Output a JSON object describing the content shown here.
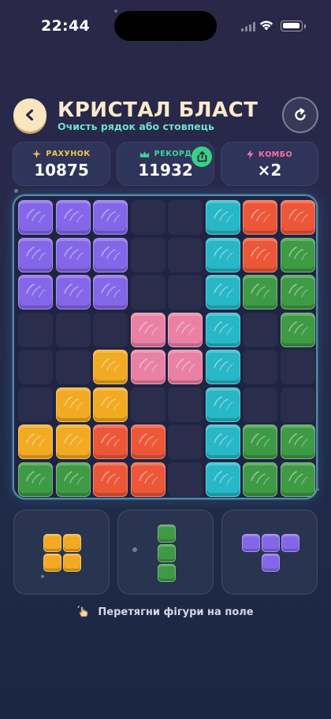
{
  "status_bar": {
    "time": "22:44"
  },
  "header": {
    "title": "КРИСТАЛ БЛАСТ",
    "subtitle": "Очисть рядок або стовпець"
  },
  "stats": {
    "score": {
      "label": "РАХУНОК",
      "value": "10875",
      "color": "#f5c54a",
      "icon": "sparkle-icon"
    },
    "record": {
      "label": "РЕКОРД",
      "value": "11932",
      "color": "#3fd49a",
      "icon": "crown-icon"
    },
    "combo": {
      "label": "КОМБО",
      "value": "×2",
      "color": "#ff6fa6",
      "icon": "lightning-icon"
    }
  },
  "colors": {
    "purple": "#8467e8",
    "teal": "#27b7c7",
    "red": "#ec5738",
    "green": "#3f9a45",
    "pink": "#ea80a3",
    "yellow": "#f1aa22"
  },
  "board": [
    [
      "purple",
      "purple",
      "purple",
      "empty",
      "empty",
      "teal",
      "red",
      "red"
    ],
    [
      "purple",
      "purple",
      "purple",
      "empty",
      "empty",
      "teal",
      "red",
      "green"
    ],
    [
      "purple",
      "purple",
      "purple",
      "empty",
      "empty",
      "teal",
      "green",
      "green"
    ],
    [
      "empty",
      "empty",
      "empty",
      "pink",
      "pink",
      "teal",
      "empty",
      "green"
    ],
    [
      "empty",
      "empty",
      "yellow",
      "pink",
      "pink",
      "teal",
      "empty",
      "empty"
    ],
    [
      "empty",
      "yellow",
      "yellow",
      "empty",
      "empty",
      "teal",
      "empty",
      "empty"
    ],
    [
      "yellow",
      "yellow",
      "red",
      "red",
      "empty",
      "teal",
      "green",
      "green"
    ],
    [
      "green",
      "green",
      "red",
      "red",
      "empty",
      "teal",
      "green",
      "green"
    ]
  ],
  "pieces": [
    {
      "color": "yellow",
      "cells": [
        [
          0,
          0
        ],
        [
          0,
          1
        ],
        [
          1,
          0
        ],
        [
          1,
          1
        ]
      ]
    },
    {
      "color": "green",
      "cells": [
        [
          0,
          0
        ],
        [
          1,
          0
        ],
        [
          2,
          0
        ]
      ]
    },
    {
      "color": "purple",
      "cells": [
        [
          0,
          0
        ],
        [
          0,
          1
        ],
        [
          0,
          2
        ],
        [
          1,
          1
        ]
      ]
    }
  ],
  "hint": {
    "text": "Перетягни фігури на поле",
    "icon": "hand-drag-icon"
  }
}
